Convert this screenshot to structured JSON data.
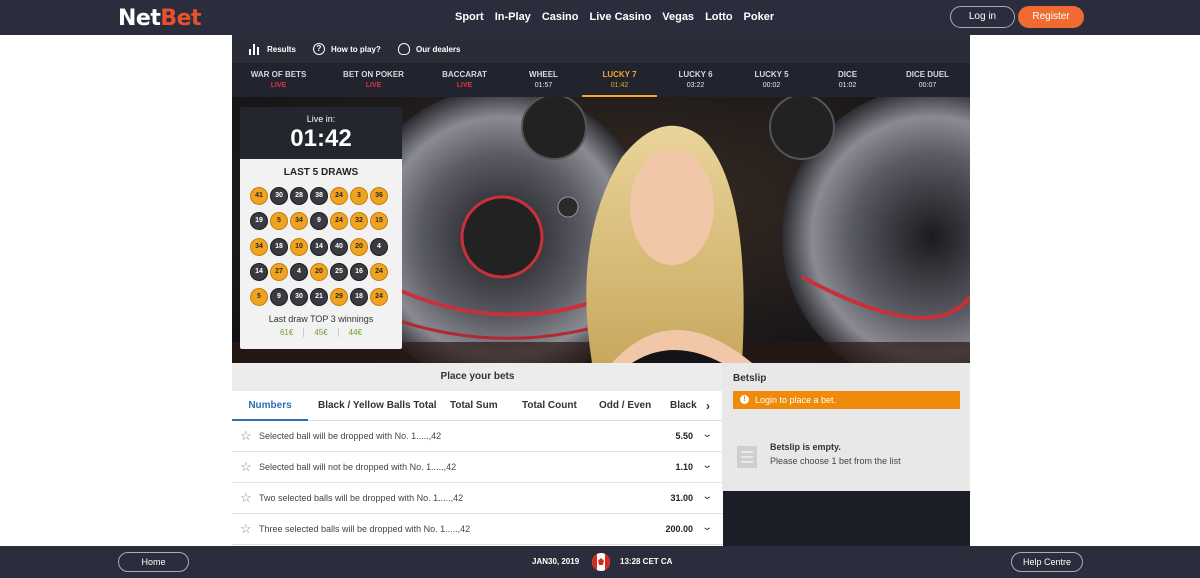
{
  "header": {
    "logo_net": "Net",
    "logo_bet": "Bet",
    "nav": [
      "Sport",
      "In-Play",
      "Casino",
      "Live Casino",
      "Vegas",
      "Lotto",
      "Poker"
    ],
    "login": "Log in",
    "register": "Register"
  },
  "game_toolbar": {
    "results": "Results",
    "how_to_play": "How to play?",
    "our_dealers": "Our dealers"
  },
  "game_tabs": [
    {
      "name": "WAR OF BETS",
      "status": "LIVE"
    },
    {
      "name": "BET ON POKER",
      "status": "LIVE"
    },
    {
      "name": "BACCARAT",
      "status": "LIVE"
    },
    {
      "name": "WHEEL",
      "status": "01:57"
    },
    {
      "name": "LUCKY 7",
      "status": "01:42"
    },
    {
      "name": "LUCKY 6",
      "status": "03:22"
    },
    {
      "name": "LUCKY 5",
      "status": "00:02"
    },
    {
      "name": "DICE",
      "status": "01:02"
    },
    {
      "name": "DICE DUEL",
      "status": "00:07"
    }
  ],
  "draws_panel": {
    "live_in_label": "Live in:",
    "countdown": "01:42",
    "title": "LAST 5 DRAWS",
    "rows": [
      [
        {
          "n": "41",
          "c": "y"
        },
        {
          "n": "30",
          "c": "b"
        },
        {
          "n": "28",
          "c": "b"
        },
        {
          "n": "38",
          "c": "b"
        },
        {
          "n": "24",
          "c": "y"
        },
        {
          "n": "3",
          "c": "y"
        },
        {
          "n": "36",
          "c": "y"
        }
      ],
      [
        {
          "n": "19",
          "c": "b"
        },
        {
          "n": "5",
          "c": "y"
        },
        {
          "n": "34",
          "c": "y"
        },
        {
          "n": "9",
          "c": "b"
        },
        {
          "n": "24",
          "c": "y"
        },
        {
          "n": "32",
          "c": "y"
        },
        {
          "n": "15",
          "c": "y"
        }
      ],
      [
        {
          "n": "34",
          "c": "y"
        },
        {
          "n": "18",
          "c": "b"
        },
        {
          "n": "10",
          "c": "y"
        },
        {
          "n": "14",
          "c": "b"
        },
        {
          "n": "40",
          "c": "b"
        },
        {
          "n": "20",
          "c": "y"
        },
        {
          "n": "4",
          "c": "b"
        }
      ],
      [
        {
          "n": "14",
          "c": "b"
        },
        {
          "n": "27",
          "c": "y"
        },
        {
          "n": "4",
          "c": "b"
        },
        {
          "n": "20",
          "c": "y"
        },
        {
          "n": "25",
          "c": "b"
        },
        {
          "n": "16",
          "c": "b"
        },
        {
          "n": "24",
          "c": "y"
        }
      ],
      [
        {
          "n": "5",
          "c": "y"
        },
        {
          "n": "9",
          "c": "b"
        },
        {
          "n": "30",
          "c": "b"
        },
        {
          "n": "21",
          "c": "b"
        },
        {
          "n": "29",
          "c": "y"
        },
        {
          "n": "18",
          "c": "b"
        },
        {
          "n": "24",
          "c": "y"
        }
      ]
    ],
    "top3_label": "Last draw TOP 3 winnings",
    "top3": [
      "61€",
      "45€",
      "44€"
    ]
  },
  "bets": {
    "title": "Place your bets",
    "tabs": [
      "Numbers",
      "Black / Yellow Balls Total",
      "Total Sum",
      "Total Count",
      "Odd / Even",
      "Black"
    ],
    "rows": [
      {
        "text": "Selected ball will be dropped with No. 1.....,42",
        "odd": "5.50"
      },
      {
        "text": "Selected ball will not be dropped with No. 1.....,42",
        "odd": "1.10"
      },
      {
        "text": "Two selected balls will be dropped with No. 1.....,42",
        "odd": "31.00"
      },
      {
        "text": "Three selected balls will be dropped with No. 1.....,42",
        "odd": "200.00"
      }
    ]
  },
  "betslip": {
    "title": "Betslip",
    "login_notice": "Login to place a bet.",
    "empty_title": "Betslip is empty.",
    "empty_sub": "Please choose 1 bet from the list"
  },
  "footer": {
    "home": "Home",
    "date": "JAN30, 2019",
    "time": "13:28 CET CA",
    "help": "Help Centre"
  },
  "colors": {
    "nav_bg": "#2b2d3c",
    "accent_orange": "#f06b32",
    "active_tab": "#f5a623",
    "live_red": "#e0343a",
    "link_blue": "#2a6fb5",
    "ball_yellow": "#f0a31e",
    "ball_black": "#3a3b40"
  }
}
